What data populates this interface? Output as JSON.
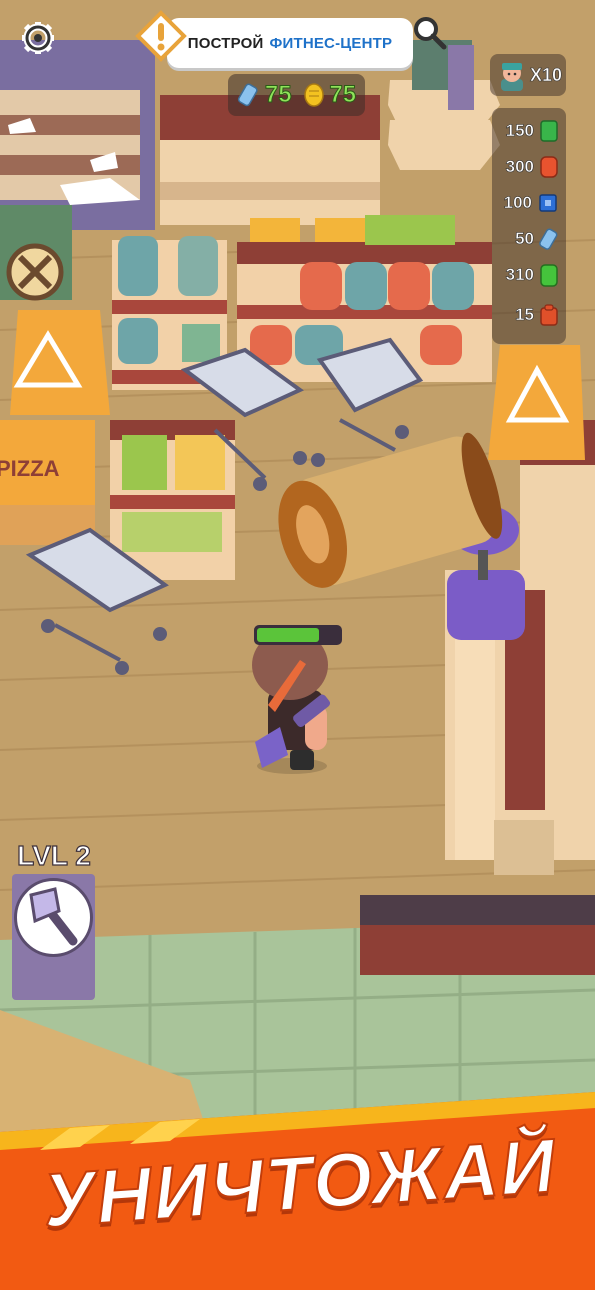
{
  "quest": {
    "prefix": "ПОСТРОЙ",
    "target": "ФИТНЕС-ЦЕНТР"
  },
  "resources": [
    {
      "icon": "blue-crystal-icon",
      "value": "75"
    },
    {
      "icon": "gold-coins-icon",
      "value": "75"
    }
  ],
  "workers": {
    "icon": "worker-avatar-icon",
    "count": "X10"
  },
  "inventory": [
    {
      "icon": "green-cash-icon",
      "value": "150",
      "color": "#39b54a"
    },
    {
      "icon": "red-can-icon",
      "value": "300",
      "color": "#e8532f"
    },
    {
      "icon": "blue-chip-icon",
      "value": "100",
      "color": "#2d6fd6"
    },
    {
      "icon": "blue-crystal-icon",
      "value": "50",
      "color": "#8bc2ee"
    },
    {
      "icon": "green-jar-icon",
      "value": "310",
      "color": "#45c43c"
    },
    {
      "icon": "red-bag-icon",
      "value": "15",
      "color": "#e0502a"
    }
  ],
  "player": {
    "health_fraction": 0.75
  },
  "level": {
    "label": "LVL 2",
    "tool_icon": "axe-icon"
  },
  "banner": {
    "text": "УНИЧТОЖАЙ"
  },
  "signs": {
    "pizza": "PIZZA"
  },
  "colors": {
    "health": "#5bc43a",
    "banner": "#f25a12",
    "quest_accent": "#1f72c9"
  }
}
